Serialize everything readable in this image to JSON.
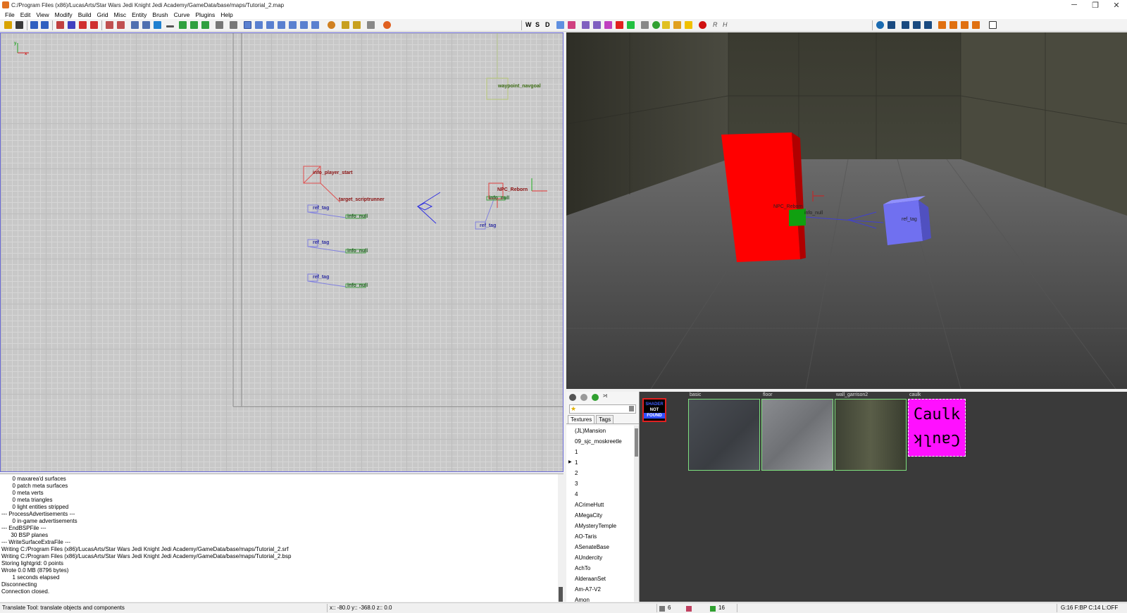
{
  "window": {
    "title": "C:/Program Files (x86)/LucasArts/Star Wars Jedi Knight Jedi Academy/GameData/base/maps/Tutorial_2.map",
    "minimize": "─",
    "maximize": "❐",
    "close": "✕"
  },
  "menu": [
    "File",
    "Edit",
    "View",
    "Modify",
    "Build",
    "Grid",
    "Misc",
    "Entity",
    "Brush",
    "Curve",
    "Plugins",
    "Help"
  ],
  "toolbar_right_letters": [
    "W",
    "S",
    "D",
    "R",
    "H"
  ],
  "view2d": {
    "axis_y": "y",
    "axis_x": "x",
    "labels": {
      "waypoint": "waypoint_navgoal",
      "player_start": "info_player_start",
      "scriptrunner": "target_scriptrunner",
      "npc": "NPC_Reborn",
      "ref_tag": "ref_tag",
      "info_null": "info_null"
    }
  },
  "view3d": {
    "npc_label": "NPC_Reborn",
    "null_label": "info_null",
    "ref_label": "ref_tag"
  },
  "console": {
    "lines": [
      "       0 maxarea'd surfaces",
      "       0 patch meta surfaces",
      "       0 meta verts",
      "       0 meta triangles",
      "       0 light entities stripped",
      "--- ProcessAdvertisements ---",
      "       0 in-game advertisements",
      "--- EndBSPFile ---",
      "      30 BSP planes",
      "--- WriteSurfaceExtraFile ---",
      "Writing C:/Program Files (x86)/LucasArts/Star Wars Jedi Knight Jedi Academy/GameData/base/maps/Tutorial_2.srf",
      "Writing C:/Program Files (x86)/LucasArts/Star Wars Jedi Knight Jedi Academy/GameData/base/maps/Tutorial_2.bsp",
      "Storing lightgrid: 0 points",
      "Wrote 0.0 MB (8796 bytes)",
      "       1 seconds elapsed",
      "Disconnecting",
      "Connection closed."
    ]
  },
  "texture_browser": {
    "tabs": [
      "Textures",
      "Tags"
    ],
    "tree": [
      "(JL)Mansion",
      "09_sjc_moskreetle",
      "1",
      "1",
      "2",
      "3",
      "4",
      "ACrimeHutt",
      "AMegaCity",
      "AMysteryTemple",
      "AO-Taris",
      "ASenateBase",
      "AUndercity",
      "AchTo",
      "AlderaanSet",
      "Am-A7-V2",
      "Amon"
    ],
    "expandable_index": 3,
    "shader_not_found": [
      "SHADER",
      "NOT",
      "FOUND"
    ],
    "textures": [
      "basic",
      "floor",
      "wall_garrison2",
      "caulk"
    ],
    "caulk_text": "Caulk"
  },
  "status": {
    "tool": "Translate Tool: translate objects and components",
    "coords": "x:: -80.0  y:: -368.0  z::    0.0",
    "brushes": "6",
    "entities": "16",
    "grid": "G:16  F:BP  C:14  L:OFF"
  }
}
